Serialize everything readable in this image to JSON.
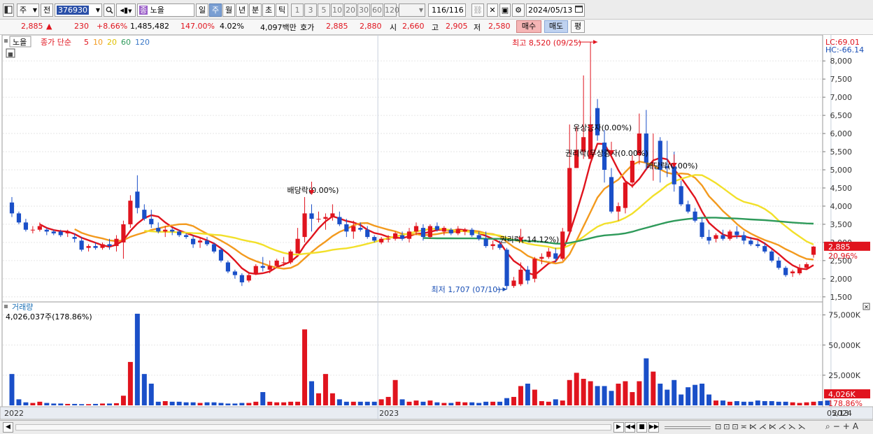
{
  "toolbar": {
    "period_type": "주",
    "compare": "전",
    "code": "376930",
    "name_badge": "종",
    "name": "노을",
    "tabs": [
      "일",
      "주",
      "월",
      "년",
      "분",
      "초",
      "틱"
    ],
    "active_tab": "주",
    "intervals": [
      "1",
      "3",
      "5",
      "10",
      "20",
      "30",
      "60",
      "120"
    ],
    "count_value": "116",
    "count_total": "/116",
    "date": "2024/05/13"
  },
  "info": {
    "price": "2,885",
    "arrow": "▲",
    "change": "230",
    "change_pct": "+8.66%",
    "volume": "1,485,482",
    "vol_ratio": "147.00%",
    "turnover": "4.02%",
    "amount": "4,097백만",
    "quote_label": "호가",
    "ask": "2,885",
    "bid": "2,880",
    "open_label": "시",
    "open": "2,660",
    "high_label": "고",
    "high": "2,905",
    "low_label": "저",
    "low": "2,580",
    "buy_label": "매수",
    "sell_label": "매도",
    "avg_label": "평"
  },
  "chart_data": {
    "type": "candlestick",
    "period": "weekly",
    "legend": {
      "name": "노을",
      "ma_label": "종가 단순",
      "ma": [
        {
          "period": "5",
          "color": "#e0141e"
        },
        {
          "period": "10",
          "color": "#f39a1e"
        },
        {
          "period": "20",
          "color": "#f2e02a"
        },
        {
          "period": "60",
          "color": "#2e9a5a"
        },
        {
          "period": "120",
          "color": "#3a78c8"
        }
      ]
    },
    "lc_label": "LC:69.01",
    "hc_label": "HC:-66.14",
    "ylim": [
      1400,
      8600
    ],
    "yticks": [
      1500,
      2000,
      2500,
      3000,
      3500,
      4000,
      4500,
      5000,
      5500,
      6000,
      6500,
      7000,
      7500,
      8000
    ],
    "ytick_labels": [
      "1,500",
      "2,000",
      "2,500",
      "3,000",
      "3,500",
      "4,000",
      "4,500",
      "5,000",
      "5,500",
      "6,000",
      "6,500",
      "7,000",
      "7,500",
      "8,000"
    ],
    "x_labels": [
      "2022",
      "2023",
      "2024",
      "05/13"
    ],
    "last_price_tag": "2,885",
    "last_pct_tag": "20.96%",
    "annotations": {
      "high": "최고 8,520 (09/25)",
      "low": "최저 1,707 (07/10)",
      "dividend": "배당락(0.00%)",
      "rights_1": "권리락(-14.12%)",
      "paid_increase": "유상증자(0.00%)",
      "rights_2": "권리락(무상증자(0.00%)",
      "ex_rights": "배당락(0.00%)"
    },
    "candles": [
      [
        4100,
        4250,
        3700,
        3800
      ],
      [
        3800,
        3850,
        3500,
        3550
      ],
      [
        3550,
        3650,
        3300,
        3350
      ],
      [
        3350,
        3450,
        3250,
        3350
      ],
      [
        3350,
        3550,
        3300,
        3450
      ],
      [
        3350,
        3400,
        3200,
        3300
      ],
      [
        3300,
        3350,
        3200,
        3250
      ],
      [
        3300,
        3350,
        3150,
        3200
      ],
      [
        3250,
        3350,
        3150,
        3300
      ],
      [
        3150,
        3250,
        3000,
        3100
      ],
      [
        3050,
        3150,
        2750,
        2800
      ],
      [
        2850,
        2950,
        2750,
        2900
      ],
      [
        2900,
        3000,
        2800,
        2850
      ],
      [
        2850,
        3000,
        2800,
        2950
      ],
      [
        2950,
        3100,
        2800,
        2900
      ],
      [
        2900,
        3200,
        2750,
        3100
      ],
      [
        3000,
        3600,
        2550,
        3500
      ],
      [
        3500,
        4300,
        3400,
        4150
      ],
      [
        4400,
        4850,
        3800,
        3950
      ],
      [
        3900,
        4050,
        3600,
        3650
      ],
      [
        3650,
        3900,
        3400,
        3500
      ],
      [
        3400,
        3550,
        3250,
        3300
      ],
      [
        3300,
        3450,
        3150,
        3350
      ],
      [
        3350,
        3400,
        3200,
        3300
      ],
      [
        3300,
        3350,
        3150,
        3200
      ],
      [
        3200,
        3250,
        3100,
        3150
      ],
      [
        3100,
        3200,
        2850,
        2950
      ],
      [
        3000,
        3150,
        2850,
        3050
      ],
      [
        3050,
        3150,
        2900,
        2950
      ],
      [
        2950,
        3000,
        2700,
        2750
      ],
      [
        2800,
        2850,
        2450,
        2500
      ],
      [
        2450,
        2500,
        2150,
        2200
      ],
      [
        2200,
        2250,
        2000,
        2100
      ],
      [
        2100,
        2150,
        1800,
        1900
      ],
      [
        1950,
        2150,
        1900,
        2100
      ],
      [
        2150,
        2400,
        2100,
        2350
      ],
      [
        2350,
        2600,
        2200,
        2300
      ],
      [
        2250,
        2500,
        2150,
        2350
      ],
      [
        2350,
        2550,
        2300,
        2500
      ],
      [
        2450,
        2600,
        2350,
        2450
      ],
      [
        2450,
        2800,
        2400,
        2750
      ],
      [
        2700,
        3400,
        2700,
        3100
      ],
      [
        3150,
        4250,
        3000,
        3800
      ],
      [
        3800,
        4050,
        3300,
        3650
      ],
      [
        3650,
        3850,
        3550,
        3650
      ],
      [
        3650,
        3800,
        3350,
        3700
      ],
      [
        3700,
        4050,
        3600,
        3800
      ],
      [
        3700,
        3850,
        3450,
        3500
      ],
      [
        3500,
        3650,
        3150,
        3300
      ],
      [
        3300,
        3600,
        3100,
        3450
      ],
      [
        3400,
        3550,
        3300,
        3350
      ],
      [
        3350,
        3450,
        3100,
        3150
      ],
      [
        3150,
        3200,
        3000,
        3050
      ],
      [
        3000,
        3150,
        2950,
        3100
      ],
      [
        3100,
        3200,
        3000,
        3100
      ],
      [
        3100,
        3300,
        3050,
        3250
      ],
      [
        3200,
        3300,
        3050,
        3100
      ],
      [
        3100,
        3400,
        3000,
        3300
      ],
      [
        3300,
        3550,
        3200,
        3450
      ],
      [
        3400,
        3500,
        3050,
        3150
      ],
      [
        3150,
        3500,
        3100,
        3450
      ],
      [
        3450,
        3550,
        3300,
        3350
      ],
      [
        3300,
        3450,
        3200,
        3400
      ],
      [
        3350,
        3400,
        3200,
        3250
      ],
      [
        3250,
        3450,
        3200,
        3350
      ],
      [
        3300,
        3400,
        3200,
        3350
      ],
      [
        3350,
        3400,
        3150,
        3200
      ],
      [
        3200,
        3300,
        3050,
        3100
      ],
      [
        3100,
        3300,
        2850,
        2900
      ],
      [
        2900,
        3050,
        2800,
        2950
      ],
      [
        2950,
        3050,
        2800,
        2850
      ],
      [
        2800,
        2850,
        1707,
        1800
      ],
      [
        1800,
        2050,
        1750,
        1950
      ],
      [
        1850,
        2450,
        1800,
        2250
      ],
      [
        2250,
        2350,
        1850,
        1950
      ],
      [
        2000,
        2600,
        1900,
        2550
      ],
      [
        2550,
        2700,
        2400,
        2600
      ],
      [
        2600,
        2850,
        2550,
        2750
      ],
      [
        2700,
        2850,
        2450,
        2550
      ],
      [
        2550,
        3400,
        2500,
        3300
      ],
      [
        3300,
        6250,
        3300,
        5050
      ],
      [
        5050,
        6200,
        5050,
        5550
      ],
      [
        5500,
        7600,
        5300,
        5900
      ],
      [
        5300,
        8520,
        5300,
        6150
      ],
      [
        6700,
        6950,
        5800,
        5950
      ],
      [
        5750,
        6100,
        4650,
        5000
      ],
      [
        4800,
        5050,
        3800,
        3850
      ],
      [
        3850,
        4100,
        3600,
        4000
      ],
      [
        3950,
        4700,
        3800,
        4650
      ],
      [
        4650,
        5400,
        4500,
        5250
      ],
      [
        5400,
        6550,
        5150,
        6000
      ],
      [
        6000,
        6650,
        5000,
        5200
      ],
      [
        5200,
        6000,
        4700,
        5200
      ],
      [
        5800,
        5900,
        4650,
        5000
      ],
      [
        5100,
        5800,
        4800,
        5050
      ],
      [
        5100,
        5500,
        4400,
        4600
      ],
      [
        4550,
        4700,
        4000,
        4050
      ],
      [
        4050,
        4150,
        3800,
        3850
      ],
      [
        3850,
        3950,
        3550,
        3600
      ],
      [
        3550,
        3700,
        3100,
        3150
      ],
      [
        3150,
        3350,
        2950,
        3050
      ],
      [
        3100,
        3250,
        3000,
        3200
      ],
      [
        3200,
        3350,
        3050,
        3100
      ],
      [
        3100,
        3350,
        3050,
        3300
      ],
      [
        3300,
        3450,
        3100,
        3200
      ],
      [
        3200,
        3300,
        2950,
        3050
      ],
      [
        3050,
        3150,
        2900,
        2950
      ],
      [
        2950,
        3050,
        2850,
        2900
      ],
      [
        2900,
        3000,
        2700,
        2750
      ],
      [
        2750,
        2800,
        2450,
        2500
      ],
      [
        2500,
        2600,
        2250,
        2300
      ],
      [
        2300,
        2350,
        2050,
        2100
      ],
      [
        2150,
        2250,
        2050,
        2200
      ],
      [
        2150,
        2400,
        2100,
        2300
      ],
      [
        2300,
        2450,
        2250,
        2400
      ],
      [
        2660,
        2905,
        2580,
        2885
      ]
    ],
    "volume": {
      "label": "거래량",
      "current": "4,026,037주(178.86%)",
      "ylim": [
        0,
        80000
      ],
      "yticks": [
        25000,
        50000,
        75000
      ],
      "ytick_labels": [
        "25,000K",
        "50,000K",
        "75,000K"
      ],
      "last_tag": "4,026K",
      "last_pct_tag": "178.86%",
      "values": [
        26000,
        5000,
        2500,
        2000,
        3000,
        2000,
        1500,
        1500,
        1200,
        1200,
        1000,
        1000,
        1200,
        1500,
        1500,
        1800,
        8000,
        36000,
        76000,
        26000,
        18000,
        3000,
        3500,
        3000,
        3000,
        2500,
        2500,
        2000,
        2500,
        2500,
        2000,
        1500,
        1500,
        2000,
        2000,
        3000,
        11000,
        3000,
        2500,
        2500,
        3000,
        3000,
        63000,
        20000,
        10000,
        26000,
        10000,
        5000,
        3000,
        3000,
        3000,
        3000,
        3000,
        5000,
        7000,
        21000,
        5000,
        3000,
        4000,
        3000,
        4000,
        2500,
        2000,
        2000,
        3000,
        2500,
        2500,
        2000,
        3000,
        3000,
        3000,
        6000,
        7000,
        16000,
        18000,
        13000,
        3500,
        3000,
        5000,
        4000,
        21000,
        27000,
        22000,
        20000,
        16000,
        16000,
        12000,
        18000,
        20000,
        11000,
        20000,
        39000,
        28000,
        18000,
        13000,
        21000,
        9000,
        15000,
        17000,
        18000,
        9000,
        4000,
        4000,
        3000,
        3500,
        3000,
        3000,
        4000,
        3500,
        3500,
        3000,
        3000,
        2500,
        2000,
        2500,
        3000,
        3500,
        4026
      ]
    }
  }
}
